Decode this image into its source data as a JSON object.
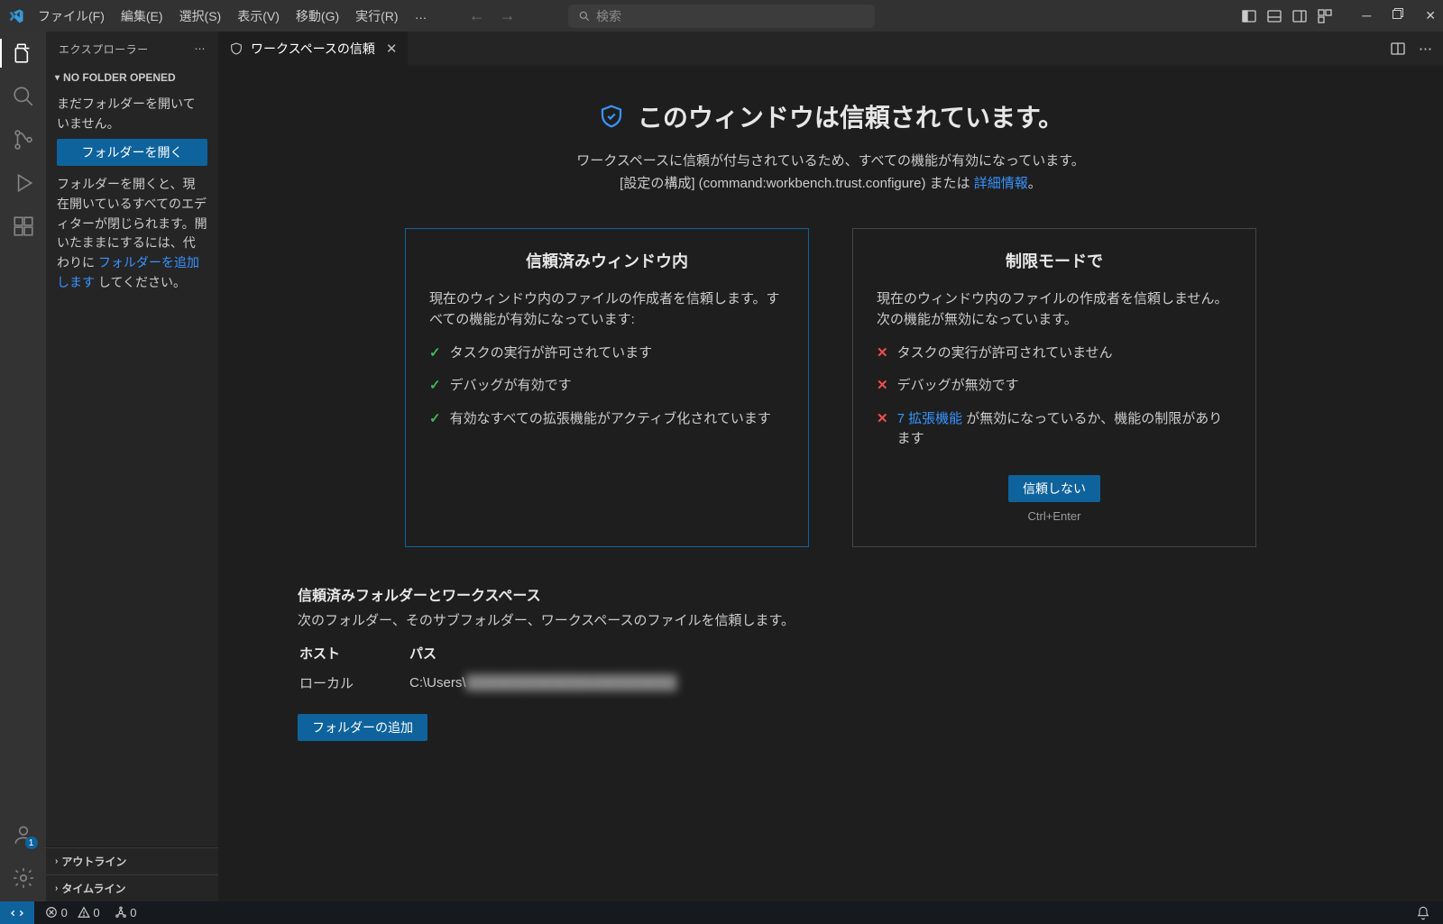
{
  "menu": {
    "file": "ファイル(F)",
    "edit": "編集(E)",
    "select": "選択(S)",
    "view": "表示(V)",
    "go": "移動(G)",
    "run": "実行(R)",
    "more": "…"
  },
  "search": {
    "placeholder": "検索"
  },
  "sidebar": {
    "title": "エクスプローラー",
    "nofolder": "NO FOLDER OPENED",
    "empty_msg": "まだフォルダーを開いていません。",
    "open_btn": "フォルダーを開く",
    "hint_prefix": "フォルダーを開くと、現在開いているすべてのエディターが閉じられます。開いたままにするには、代わりに ",
    "hint_link": "フォルダーを追加します",
    "hint_suffix": " してください。",
    "outline": "アウトライン",
    "timeline": "タイムライン"
  },
  "tab": {
    "label": "ワークスペースの信頼"
  },
  "trust": {
    "heading": "このウィンドウは信頼されています。",
    "sub1": "ワークスペースに信頼が付与されているため、すべての機能が有効になっています。",
    "sub2_prefix": "[設定の構成] (command:workbench.trust.configure) または ",
    "sub2_link": "詳細情報",
    "sub2_suffix": "。"
  },
  "trusted_card": {
    "title": "信頼済みウィンドウ内",
    "desc": "現在のウィンドウ内のファイルの作成者を信頼します。すべての機能が有効になっています:",
    "items": [
      "タスクの実行が許可されています",
      "デバッグが有効です",
      "有効なすべての拡張機能がアクティブ化されています"
    ]
  },
  "restricted_card": {
    "title": "制限モードで",
    "desc": "現在のウィンドウ内のファイルの作成者を信頼しません。次の機能が無効になっています。",
    "items": [
      "タスクの実行が許可されていません",
      "デバッグが無効です"
    ],
    "ext_count": "7",
    "ext_link": "拡張機能",
    "ext_suffix": " が無効になっているか、機能の制限があります",
    "dont_trust_btn": "信頼しない",
    "kbd": "Ctrl+Enter"
  },
  "folders": {
    "title": "信頼済みフォルダーとワークスペース",
    "desc": "次のフォルダー、そのサブフォルダー、ワークスペースのファイルを信頼します。",
    "col_host": "ホスト",
    "col_path": "パス",
    "row_host": "ローカル",
    "row_path_visible": "C:\\Users\\",
    "row_path_blurred": "██████████████████████",
    "add_btn": "フォルダーの追加"
  },
  "status": {
    "errors": "0",
    "warnings": "0",
    "ports": "0",
    "account_badge": "1"
  }
}
